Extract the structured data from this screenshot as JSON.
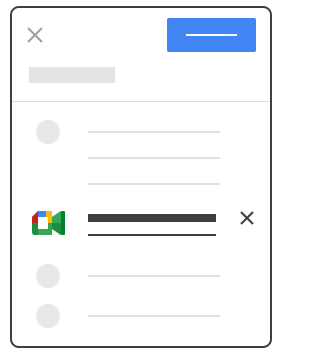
{
  "dialog": {
    "close_icon": "close-icon",
    "primary_button": {
      "label": ""
    },
    "title_placeholder": ""
  },
  "list": {
    "items": [
      {
        "icon": "avatar-placeholder",
        "label": ""
      },
      {
        "icon": "",
        "label": ""
      },
      {
        "icon": "",
        "label": ""
      },
      {
        "icon": "google-meet-icon",
        "label": "",
        "selected": true,
        "remove_icon": "close-icon"
      },
      {
        "icon": "avatar-placeholder",
        "label": ""
      },
      {
        "icon": "avatar-placeholder",
        "label": ""
      }
    ]
  },
  "colors": {
    "accent": "#4285f4",
    "border": "#3c4043",
    "placeholder": "#e3e3e3",
    "divider": "#dadce0"
  }
}
